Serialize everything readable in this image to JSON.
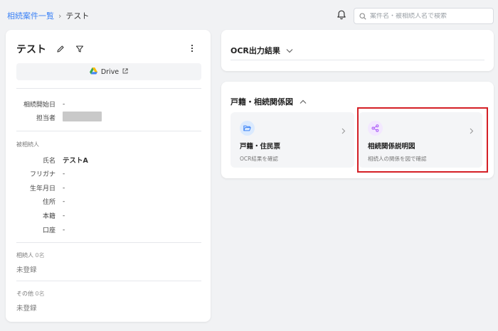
{
  "breadcrumb": {
    "parent": "相続案件一覧",
    "separator": "›",
    "current": "テスト"
  },
  "header": {
    "search_placeholder": "案件名・被相続人名で検索"
  },
  "case_panel": {
    "title": "テスト",
    "drive_label": "Drive",
    "fields_top": [
      {
        "label": "相続開始日",
        "value": "-"
      },
      {
        "label": "担当者",
        "value": ""
      }
    ],
    "decedent_section": "被相続人",
    "decedent_fields": [
      {
        "label": "氏名",
        "value": "テストA"
      },
      {
        "label": "フリガナ",
        "value": "-"
      },
      {
        "label": "生年月日",
        "value": "-"
      },
      {
        "label": "住所",
        "value": "-"
      },
      {
        "label": "本籍",
        "value": "-"
      },
      {
        "label": "口座",
        "value": "-"
      }
    ],
    "heirs": {
      "label": "相続人",
      "count": "0名",
      "empty": "未登録"
    },
    "others": {
      "label": "その他",
      "count": "0名",
      "empty": "未登録"
    }
  },
  "ocr_panel": {
    "title": "OCR出力結果"
  },
  "koseki_panel": {
    "title": "戸籍・相続関係図",
    "tiles": [
      {
        "title": "戸籍・住民票",
        "subtitle": "OCR結果を確認",
        "icon": "folder-open-icon",
        "color": "#3b82f6",
        "bg": "#dbeafe"
      },
      {
        "title": "相続関係説明図",
        "subtitle": "相続人の関係を図で確認",
        "icon": "share-nodes-icon",
        "color": "#a855f7",
        "bg": "#f3e8ff"
      }
    ]
  },
  "colors": {
    "link": "#3b82f6",
    "highlight": "#d41f25",
    "background": "#f1f2f4"
  }
}
